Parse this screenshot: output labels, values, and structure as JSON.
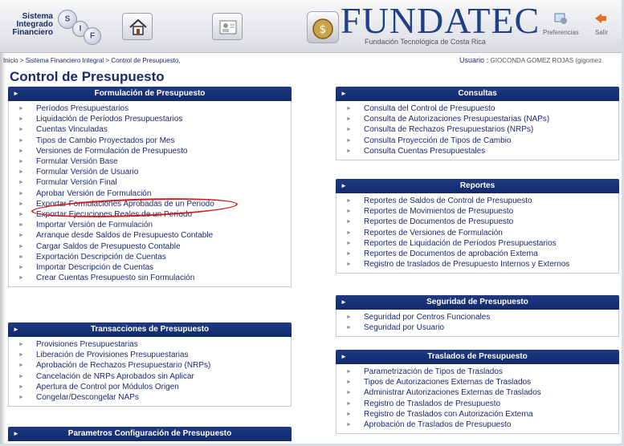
{
  "header": {
    "sif_logo": {
      "line1": "Sistema",
      "line2": "Integrado",
      "line3": "Financiero",
      "letters": [
        "S",
        "I",
        "F"
      ]
    },
    "brand_title": "FUNDATEC",
    "brand_subtitle": "Fundación Tecnológica de Costa Rica",
    "actions": [
      {
        "label": "Preferencias",
        "icon": "preferences-icon"
      },
      {
        "label": "Salir",
        "icon": "exit-icon"
      }
    ]
  },
  "breadcrumb": "Inicio > Sistema Financiero Integral > Control de Presupuesto,",
  "user": {
    "label": "Usuario :",
    "name": "GIOCONDA GOMEZ ROJAS (gigomez"
  },
  "page_title": "Control de Presupuesto",
  "panels": {
    "formulacion": {
      "title": "Formulación de Presupuesto",
      "items": [
        "Períodos Presupuestarios",
        "Liquidación de Períodos Presupuestarios",
        "Cuentas Vinculadas",
        "Tipos de Cambio Proyectados por Mes",
        "Versiones de Formulación de Presupuesto",
        "Formular Versión Base",
        "Formular Versión de Usuario",
        "Formular Versión Final",
        "Aprobar Versión de Formulación",
        "Exportar Formulaciones Aprobadas de un Periodo",
        "Exportar Ejecuciones Reales de un Período",
        "Importar Versión de Formulación",
        "Arranque desde Saldos de Presupuesto Contable",
        "Cargar Saldos de Presupuesto Contable",
        "Exportación Descripción de Cuentas",
        "Importar Descripción de Cuentas",
        "Crear Cuentas Presupuesto sin Formulación"
      ]
    },
    "transacciones": {
      "title": "Transacciones de Presupuesto",
      "items": [
        "Provisiones Presupuestarias",
        "Liberación de Provisiones Presupuestarias",
        "Aprobación de Rechazos Presupuestario (NRPs)",
        "Cancelación de NRPs Aprobados sin Aplicar",
        "Apertura de Control por Módulos Origen",
        "Congelar/Descongelar NAPs"
      ]
    },
    "parametros": {
      "title": "Parametros Configuración de Presupuesto",
      "items": []
    },
    "consultas": {
      "title": "Consultas",
      "items": [
        "Consulta del Control de Presupuesto",
        "Consulta de Autorizaciones Presupuestarias (NAPs)",
        "Consulta de Rechazos Presupuestarios (NRPs)",
        "Consulta Proyección de Tipos de Cambio",
        "Consulta Cuentas Presupuestales"
      ]
    },
    "reportes": {
      "title": "Reportes",
      "items": [
        "Reportes de Saldos de Control de Presupuesto",
        "Reportes de Movimientos de Presupuesto",
        "Reportes de Documentos de Presupuesto",
        "Reportes de Versiones de Formulación",
        "Reportes de Liquidación de Períodos Presupuestarios",
        "Reportes de Documentos de aprobación Externa",
        "Registro de traslados de Presupuesto Internos y Externos"
      ]
    },
    "seguridad": {
      "title": "Seguridad de Presupuesto",
      "items": [
        "Seguridad por Centros Funcionales",
        "Seguridad por Usuario"
      ]
    },
    "traslados": {
      "title": "Traslados de Presupuesto",
      "items": [
        "Parametrización de Tipos de Traslados",
        "Tipos de Autorizaciones Externas de Traslados",
        "Administrar Autorizaciones Externas de Traslados",
        "Registro de Traslados de Presupuesto",
        "Registro de Traslados con Autorización Externa",
        "Aprobación de Traslados de Presupuesto"
      ]
    }
  },
  "colors": {
    "panel_header": "#1f3a83",
    "link": "#1b2a6b",
    "highlight_oval": "#d11a1a"
  }
}
